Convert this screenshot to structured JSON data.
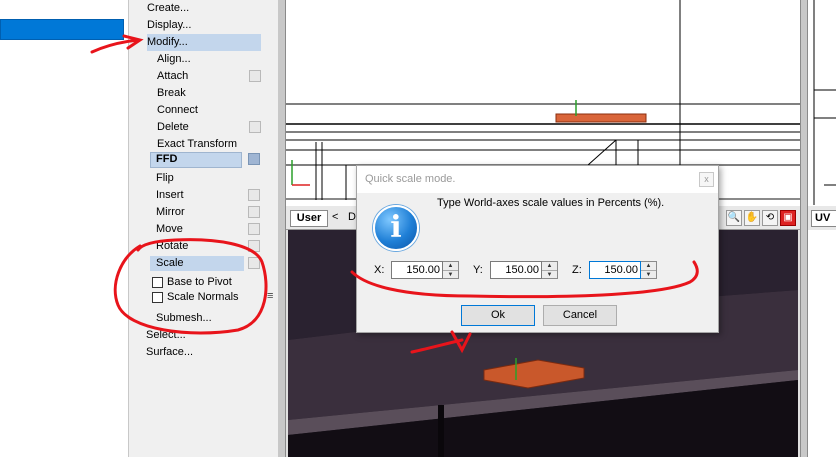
{
  "menu": {
    "top_items": [
      "Create...",
      "Display...",
      "Modify..."
    ],
    "sub_items": [
      "Align...",
      "Attach",
      "Break",
      "Connect",
      "Delete",
      "Exact Transform",
      "FFD",
      "Flip",
      "Insert",
      "Mirror",
      "Move",
      "Rotate",
      "Scale"
    ],
    "options": [
      {
        "label": "Base to Pivot",
        "checked": false
      },
      {
        "label": "Scale Normals",
        "checked": false
      }
    ],
    "bottom_items": [
      "Submesh...",
      "Select...",
      "Surface..."
    ],
    "grip": "≡"
  },
  "viewport": {
    "bottom_tab": "User",
    "nav_prev": "<",
    "nav_text": "D",
    "right_tab": "UV E",
    "tools": [
      "search-icon",
      "hand-icon",
      "orbit-icon",
      "maximize-icon"
    ],
    "tool_glyphs": [
      "🔍",
      "✋",
      "⟲",
      "▣"
    ]
  },
  "dialog": {
    "title": "Quick scale mode.",
    "close_glyph": "x",
    "icon_glyph": "i",
    "message": "Type World-axes scale values in Percents (%).",
    "fields": [
      {
        "label": "X:",
        "value": "150.00"
      },
      {
        "label": "Y:",
        "value": "150.00"
      },
      {
        "label": "Z:",
        "value": "150.00"
      }
    ],
    "ok_label": "Ok",
    "cancel_label": "Cancel"
  },
  "colors": {
    "selection_blue": "#0078d7",
    "annotation_red": "#e8141b",
    "menu_highlight": "#c3d6ec",
    "viewport_dark": "#1b1520"
  }
}
